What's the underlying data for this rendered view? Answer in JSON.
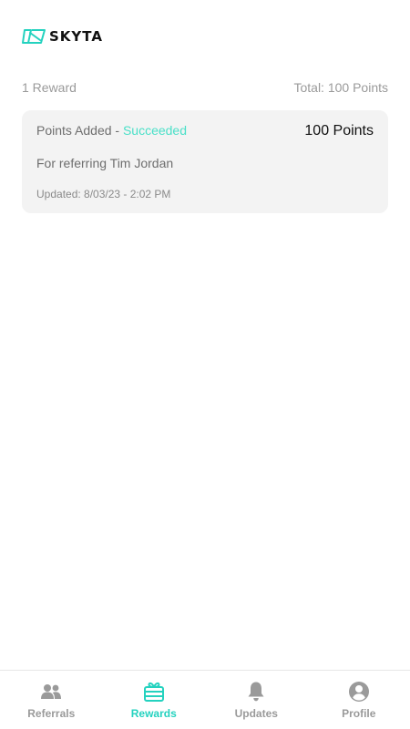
{
  "brand": {
    "name": "SKYTA",
    "accent_color": "#24d2bf"
  },
  "summary": {
    "count_label": "1 Reward",
    "total_label": "Total: 100 Points"
  },
  "reward": {
    "title": "Points Added - ",
    "status": "Succeeded",
    "status_color": "#4ae0c8",
    "points": "100 Points",
    "description": "For referring Tim Jordan",
    "updated": "Updated: 8/03/23 - 2:02 PM"
  },
  "nav": {
    "referrals": {
      "label": "Referrals",
      "icon": "people-icon"
    },
    "rewards": {
      "label": "Rewards",
      "icon": "gift-card-icon"
    },
    "updates": {
      "label": "Updates",
      "icon": "bell-icon"
    },
    "profile": {
      "label": "Profile",
      "icon": "profile-icon"
    },
    "active": "Rewards"
  }
}
